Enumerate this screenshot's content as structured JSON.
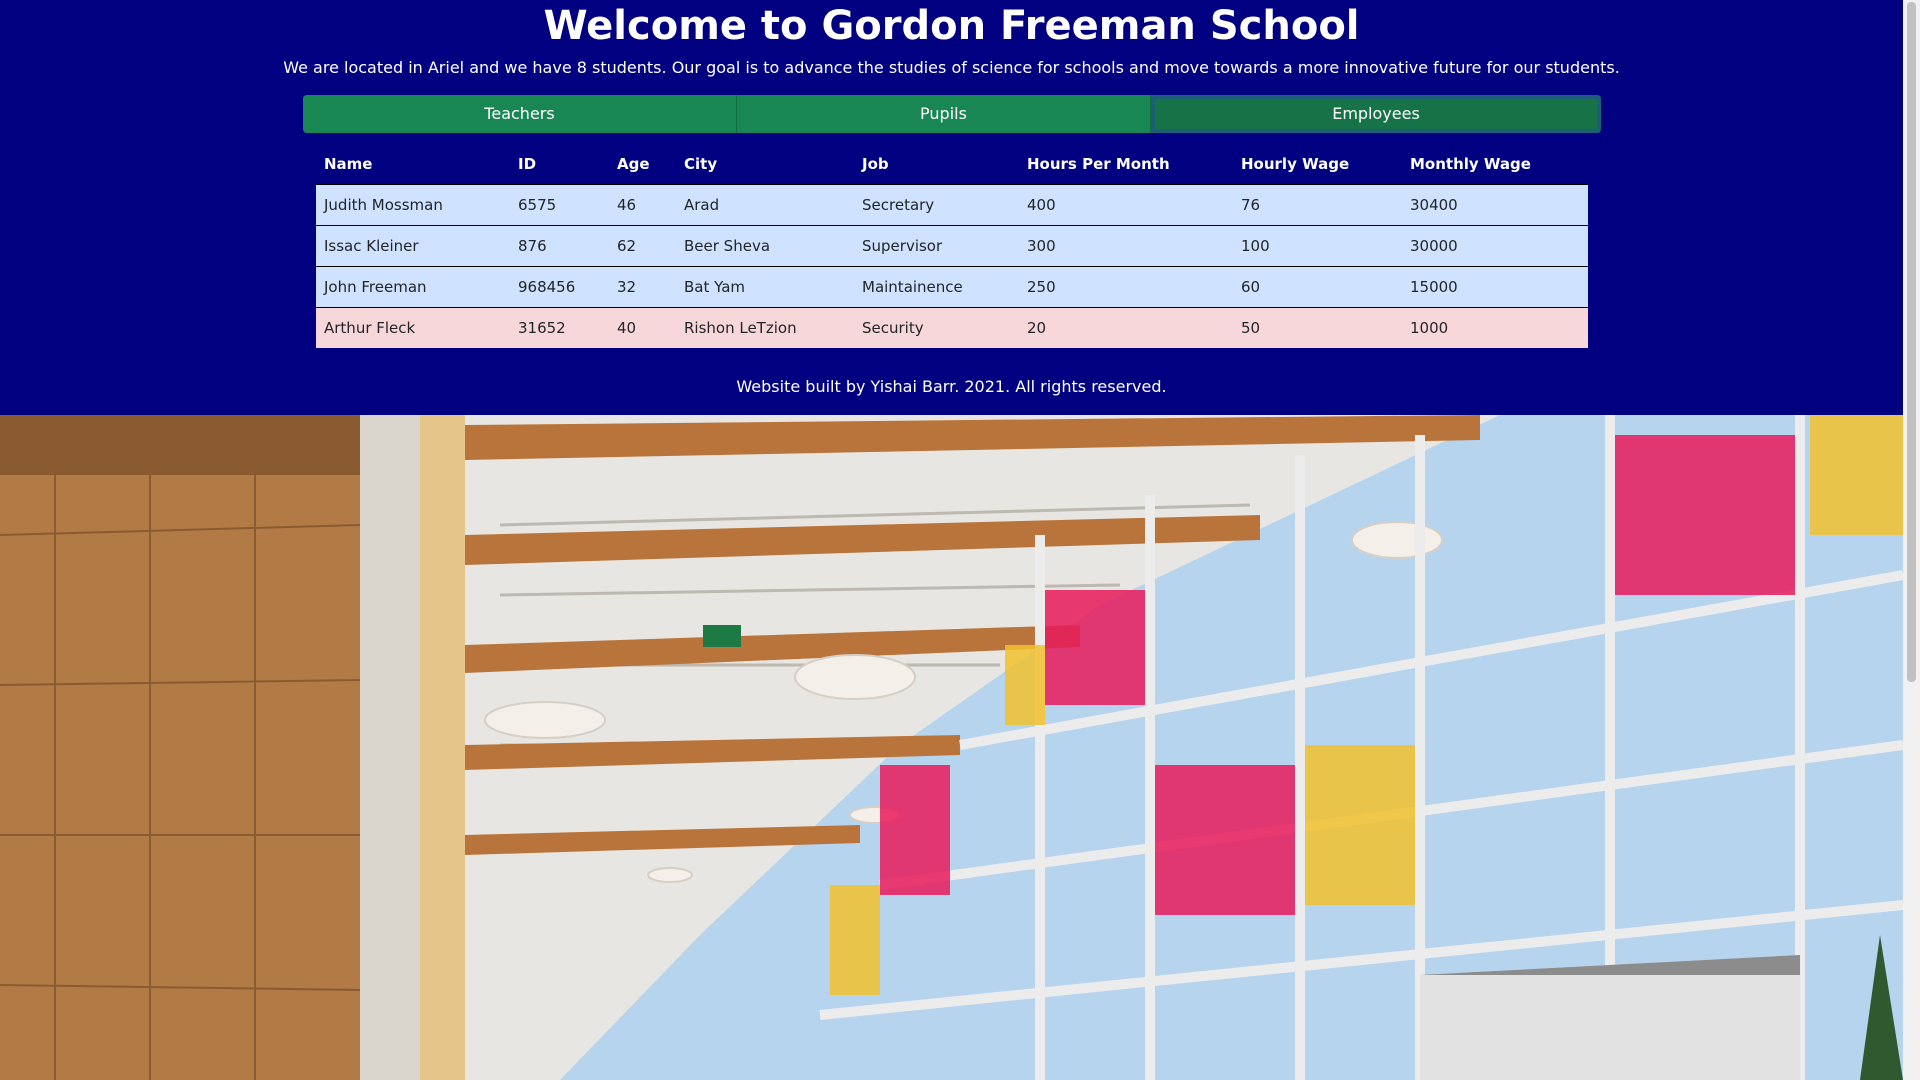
{
  "header": {
    "title": "Welcome to Gordon Freeman School",
    "subtitle": "We are located in Ariel and we have 8 students. Our goal is to advance the studies of science for schools and move towards a more innovative future for our students."
  },
  "tabs": [
    {
      "label": "Teachers"
    },
    {
      "label": "Pupils"
    },
    {
      "label": "Employees",
      "active": true
    }
  ],
  "table": {
    "columns": [
      "Name",
      "ID",
      "Age",
      "City",
      "Job",
      "Hours Per Month",
      "Hourly Wage",
      "Monthly Wage"
    ],
    "rows": [
      {
        "cells": [
          "Judith Mossman",
          "6575",
          "46",
          "Arad",
          "Secretary",
          "400",
          "76",
          "30400"
        ],
        "style": "blue"
      },
      {
        "cells": [
          "Issac Kleiner",
          "876",
          "62",
          "Beer Sheva",
          "Supervisor",
          "300",
          "100",
          "30000"
        ],
        "style": "blue"
      },
      {
        "cells": [
          "John Freeman",
          "968456",
          "32",
          "Bat Yam",
          "Maintainence",
          "250",
          "60",
          "15000"
        ],
        "style": "blue"
      },
      {
        "cells": [
          "Arthur Fleck",
          "31652",
          "40",
          "Rishon LeTzion",
          "Security",
          "20",
          "50",
          "1000"
        ],
        "style": "red"
      }
    ]
  },
  "footer": {
    "text": "Website built by Yishai Barr. 2021. All rights reserved."
  },
  "colors": {
    "background": "#000080",
    "tab_green": "#198754",
    "row_blue": "#cfe2ff",
    "row_red": "#f8d7da"
  }
}
